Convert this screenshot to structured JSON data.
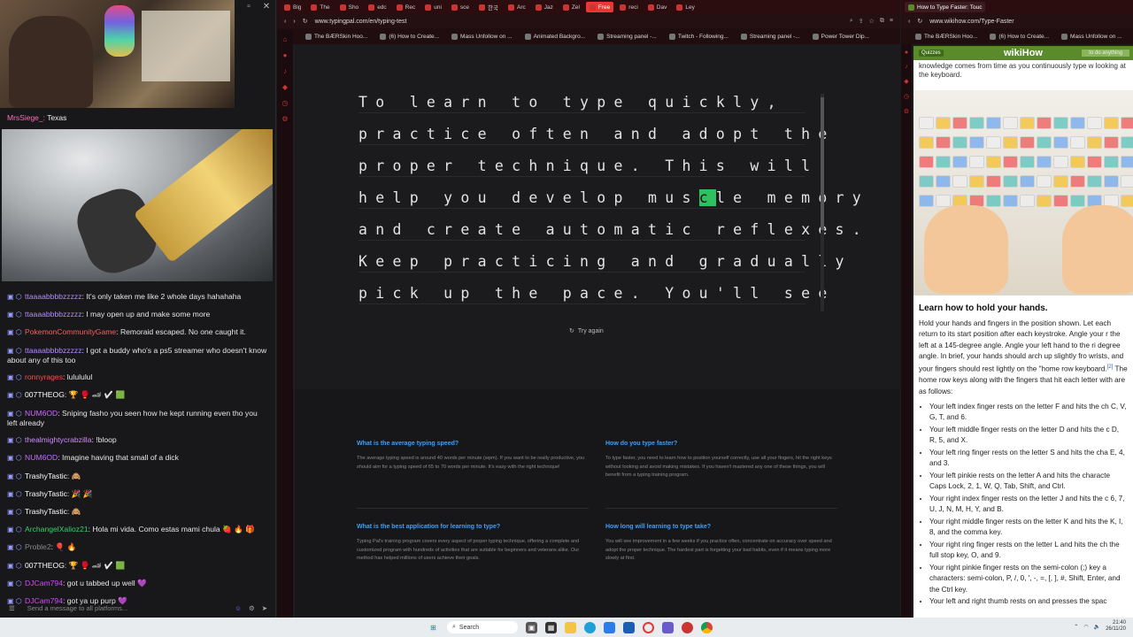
{
  "stream": {
    "mini_chat": {
      "user": "MrsSiege_:",
      "text": " Texas"
    },
    "game_timestamp": "",
    "chat_messages": [
      {
        "user": "ttaaaabbbbzzzzz",
        "color": "#b28bff",
        "text": ": It's only taken me like 2 whole days hahahaha"
      },
      {
        "user": "ttaaaabbbbzzzzz",
        "color": "#b28bff",
        "text": ": I may open up and make some more"
      },
      {
        "user": "PokemonCommunityGame",
        "color": "#ff5b5b",
        "text": ": Remoraid escaped. No one caught it."
      },
      {
        "user": "ttaaaabbbbzzzzz",
        "color": "#b28bff",
        "text": ": I got a buddy who's a ps5 streamer who doesn't know about any of this too"
      },
      {
        "user": "ronnyrages",
        "color": "#ff4d4d",
        "text": ": lulululul"
      },
      {
        "user": "007THEOG",
        "color": "#ffffff",
        "text": ": 🏆 🥊 🏎 ✔ 🟩"
      },
      {
        "user": "NUM6OD",
        "color": "#c96bff",
        "text": ": Sniping fasho you seen how he kept running even tho you left already"
      },
      {
        "user": "thealmightycrabzilla",
        "color": "#d08bff",
        "text": ": !bloop"
      },
      {
        "user": "NUM6OD",
        "color": "#c96bff",
        "text": ": Imagine having that small of a dick"
      },
      {
        "user": "TrashyTastic",
        "color": "#ffffff",
        "text": ": 🙈"
      },
      {
        "user": "TrashyTastic",
        "color": "#ffffff",
        "text": ": 🎉 🎉"
      },
      {
        "user": "TrashyTastic",
        "color": "#ffffff",
        "text": ": 🙈"
      },
      {
        "user": "ArchangelXalioz21",
        "color": "#3ad06b",
        "text": ": Hola mi vida. Como estas mami chula 🍓 🔥 🎁"
      },
      {
        "user": "Proble2",
        "color": "#888888",
        "text": ": 🎈 🔥"
      },
      {
        "user": "007THEOG",
        "color": "#ffffff",
        "text": ": 🏆 🥊 🏎 ✔ 🟩"
      },
      {
        "user": "DJCam794",
        "color": "#d04bff",
        "text": ": got u tabbed up well 💜"
      },
      {
        "user": "DJCam794",
        "color": "#d04bff",
        "text": ": got ya up purp 💜"
      }
    ],
    "chat_placeholder": "Send a message to all platforms..."
  },
  "center_browser": {
    "tabs": [
      "Big",
      "The",
      "Sho",
      "edc",
      "Rec",
      "uni",
      "sce",
      "한국",
      "Arc",
      "Jaz",
      "Zel",
      "Free",
      "reci",
      "Dav",
      "Ley"
    ],
    "active_tab": "Free",
    "url": "www.typingpal.com/en/typing-test",
    "bookmarks": [
      "The BÆRSkin Hoo...",
      "(6) How to Create...",
      "Mass Unfollow on ...",
      "Animated Backgro...",
      "Streaming panel -...",
      "Twitch - Following...",
      "Streaming panel -...",
      "Power Tower Dip..."
    ],
    "typing": {
      "lines": [
        "To learn to type quickly,",
        "practice often and adopt the",
        "proper technique. This will",
        "help you develop mus",
        "and create automatic reflexes.",
        "Keep practicing and gradually",
        "pick up the pace. You'll see"
      ],
      "cursor_char": "c",
      "line4_after": "le memory"
    },
    "try_again": "Try again",
    "faq": [
      {
        "q": "What is the average typing speed?",
        "a": "The average typing speed is around 40 words per minute (wpm). If you want to be really productive, you should aim for a typing speed of 65 to 70 words per minute. It's easy with the right technique!"
      },
      {
        "q": "How do you type faster?",
        "a": "To type faster, you need to learn how to position yourself correctly, use all your fingers, hit the right keys without looking and avoid making mistakes. If you haven't mastered any one of these things, you will benefit from a typing training program."
      },
      {
        "q": "What is the best application for learning to type?",
        "a": "Typing Pal's training program covers every aspect of proper typing technique, offering a complete and customized program with hundreds of activities that are suitable for beginners and veterans alike. Our method has helped millions of users achieve their goals."
      },
      {
        "q": "How long will learning to type take?",
        "a": "You will see improvement in a few weeks if you practice often, concentrate on accuracy over speed and adopt the proper technique. The hardest part is forgetting your bad habits, even if it means typing more slowly at first."
      }
    ]
  },
  "right_browser": {
    "tab_title": "How to Type Faster: Touc",
    "url": "www.wikihow.com/Type-Faster",
    "bookmarks": [
      "The BÆRSkin Hoo...",
      "(6) How to Create...",
      "Mass Unfollow on ..."
    ],
    "logo": "wikiHow",
    "badge": "Quizzes",
    "search_placeholder": "to do anything",
    "top_text": "knowledge comes from time as you continuously type w looking at the keyboard.",
    "heading": "Learn how to hold your hands.",
    "paragraph": "Hold your hands and fingers in the position shown. Let each return to its start position after each keystroke. Angle your r the left at a 145-degree angle. Angle your left hand to the ri degree angle. In brief, your hands should arch up slightly fro wrists, and your fingers should rest lightly on the \"home row keyboard.",
    "ref": "[2]",
    "paragraph2": " The home row keys along with the fingers that hit each letter with are as follows:",
    "list": [
      "Your left index finger rests on the letter F and hits the ch C, V, G, T, and 6.",
      "Your left middle finger rests on the letter D and hits the c D, R, 5, and X.",
      "Your left ring finger rests on the letter S and hits the cha E, 4, and 3.",
      "Your left pinkie rests on the letter A and hits the characte Caps Lock, 2, 1, W, Q, Tab, Shift, and Ctrl.",
      "Your right index finger rests on the letter J and hits the c 6, 7, U, J, N, M, H, Y, and B.",
      "Your right middle finger rests on the letter K and hits the K, I, 8, and the comma key.",
      "Your right ring finger rests on the letter L and hits the ch the full stop key, O, and 9.",
      "Your right pinkie finger rests on the semi-colon (;) key a characters: semi-colon, P, /, 0, ', -, =, [, ], #, Shift, Enter, and the Ctrl key.",
      "Your left and right thumb rests on and presses the spac"
    ]
  },
  "taskbar": {
    "search_label": "Search",
    "time": "21:40",
    "date": "26/11/20"
  },
  "colors": {
    "accent_red": "#e53935",
    "typing_cursor": "#2fc05f",
    "faq_link": "#3aa0ff",
    "wikihow_green": "#5b8a2a"
  }
}
